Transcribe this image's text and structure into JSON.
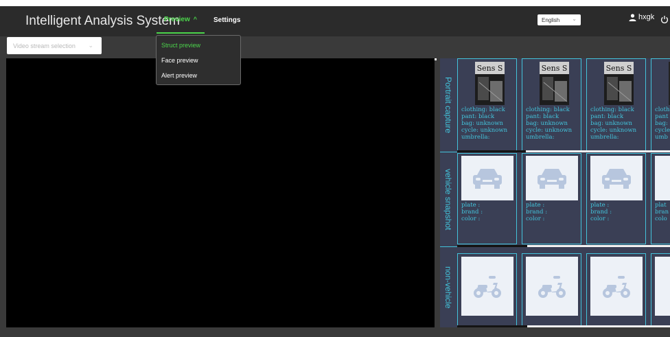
{
  "header": {
    "title": "Intelligent Analysis System",
    "nav": {
      "preview_label": "Preview",
      "settings_label": "Settings"
    },
    "language": "English",
    "user": "hxgk"
  },
  "stream_select": {
    "placeholder": "Video stream selection"
  },
  "preview_menu": {
    "items": [
      {
        "label": "Struct preview",
        "active": true
      },
      {
        "label": "Face preview",
        "active": false
      },
      {
        "label": "Alert preview",
        "active": false
      }
    ]
  },
  "panel": {
    "categories": [
      "Portrait capture",
      "vehicle snapshot",
      "non-vehicle"
    ],
    "portraits": [
      {
        "sign": "Sens S",
        "clothing": "clothing: black",
        "pant": "pant: black",
        "bag": "bag: unknown",
        "cycle": "cycle: unknown",
        "umbrella": "umbrella:"
      },
      {
        "sign": "Sens S",
        "clothing": "clothing: black",
        "pant": "pant: black",
        "bag": "bag: unknown",
        "cycle": "cycle: unknown",
        "umbrella": "umbrella:"
      },
      {
        "sign": "Sens S",
        "clothing": "clothing: black",
        "pant": "pant: black",
        "bag": "bag: unknown",
        "cycle": "cycle: unknown",
        "umbrella": "umbrella:"
      },
      {
        "sign": "",
        "clothing": "cloth",
        "pant": "pant",
        "bag": "bag:",
        "cycle": "cycle",
        "umbrella": "umb"
      }
    ],
    "vehicles": [
      {
        "plate": "plate :",
        "brand": "brand :",
        "color": "color :"
      },
      {
        "plate": "plate :",
        "brand": "brand :",
        "color": "color :"
      },
      {
        "plate": "plate :",
        "brand": "brand :",
        "color": "color :"
      },
      {
        "plate": "plat",
        "brand": "bran",
        "color": "colo"
      }
    ]
  },
  "colors": {
    "accent": "#4bd54b",
    "cyan": "#43c4dc",
    "panel_bg": "#3a3f55"
  },
  "icons": [
    "user-icon",
    "power-icon",
    "chevron-up-icon",
    "chevron-down-icon",
    "car-placeholder-icon",
    "scooter-placeholder-icon"
  ]
}
